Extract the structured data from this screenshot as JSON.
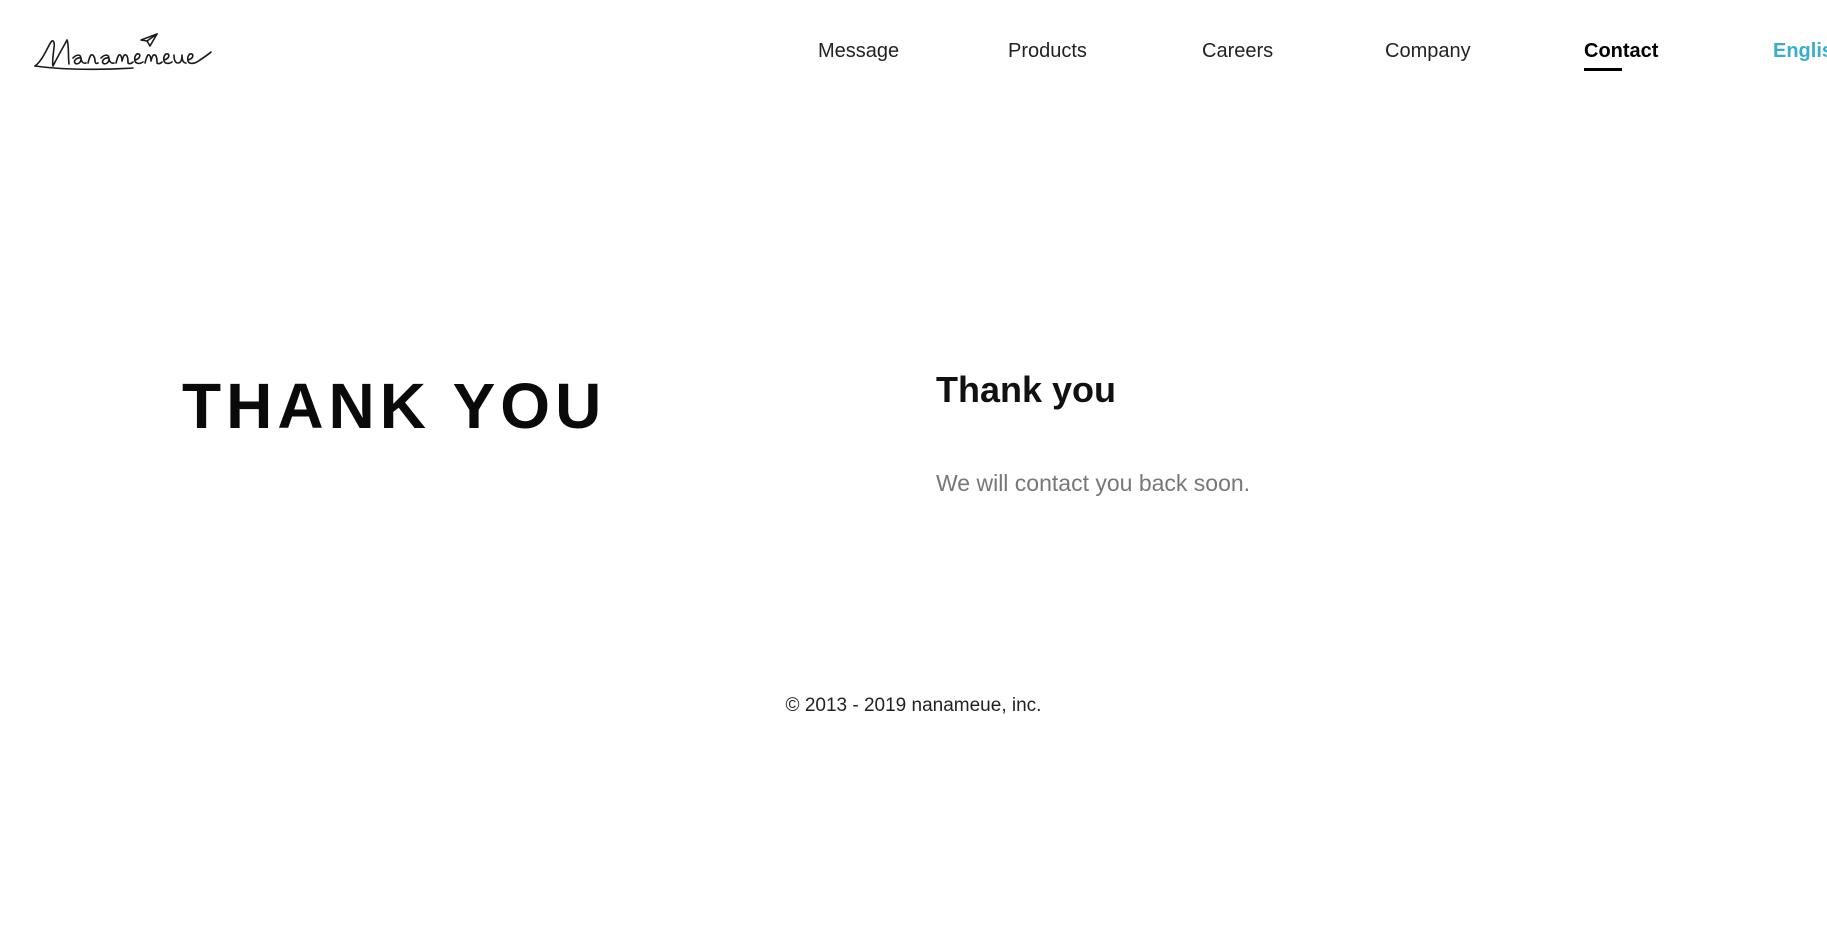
{
  "header": {
    "logo": {
      "text": "Nanameue",
      "icon": "paper-plane-logo-icon"
    },
    "nav": [
      {
        "label": "Message",
        "active": false
      },
      {
        "label": "Products",
        "active": false
      },
      {
        "label": "Careers",
        "active": false
      },
      {
        "label": "Company",
        "active": false
      },
      {
        "label": "Contact",
        "active": true
      }
    ],
    "language": "English"
  },
  "hero": {
    "title": "THANK YOU"
  },
  "main": {
    "heading": "Thank you",
    "message": "We will contact you back soon."
  },
  "footer": {
    "copyright": "© 2013 - 2019 nanameue, inc."
  },
  "colors": {
    "accent": "#3aaec9",
    "text": "#111111",
    "muted": "#777777",
    "background": "#ffffff"
  }
}
